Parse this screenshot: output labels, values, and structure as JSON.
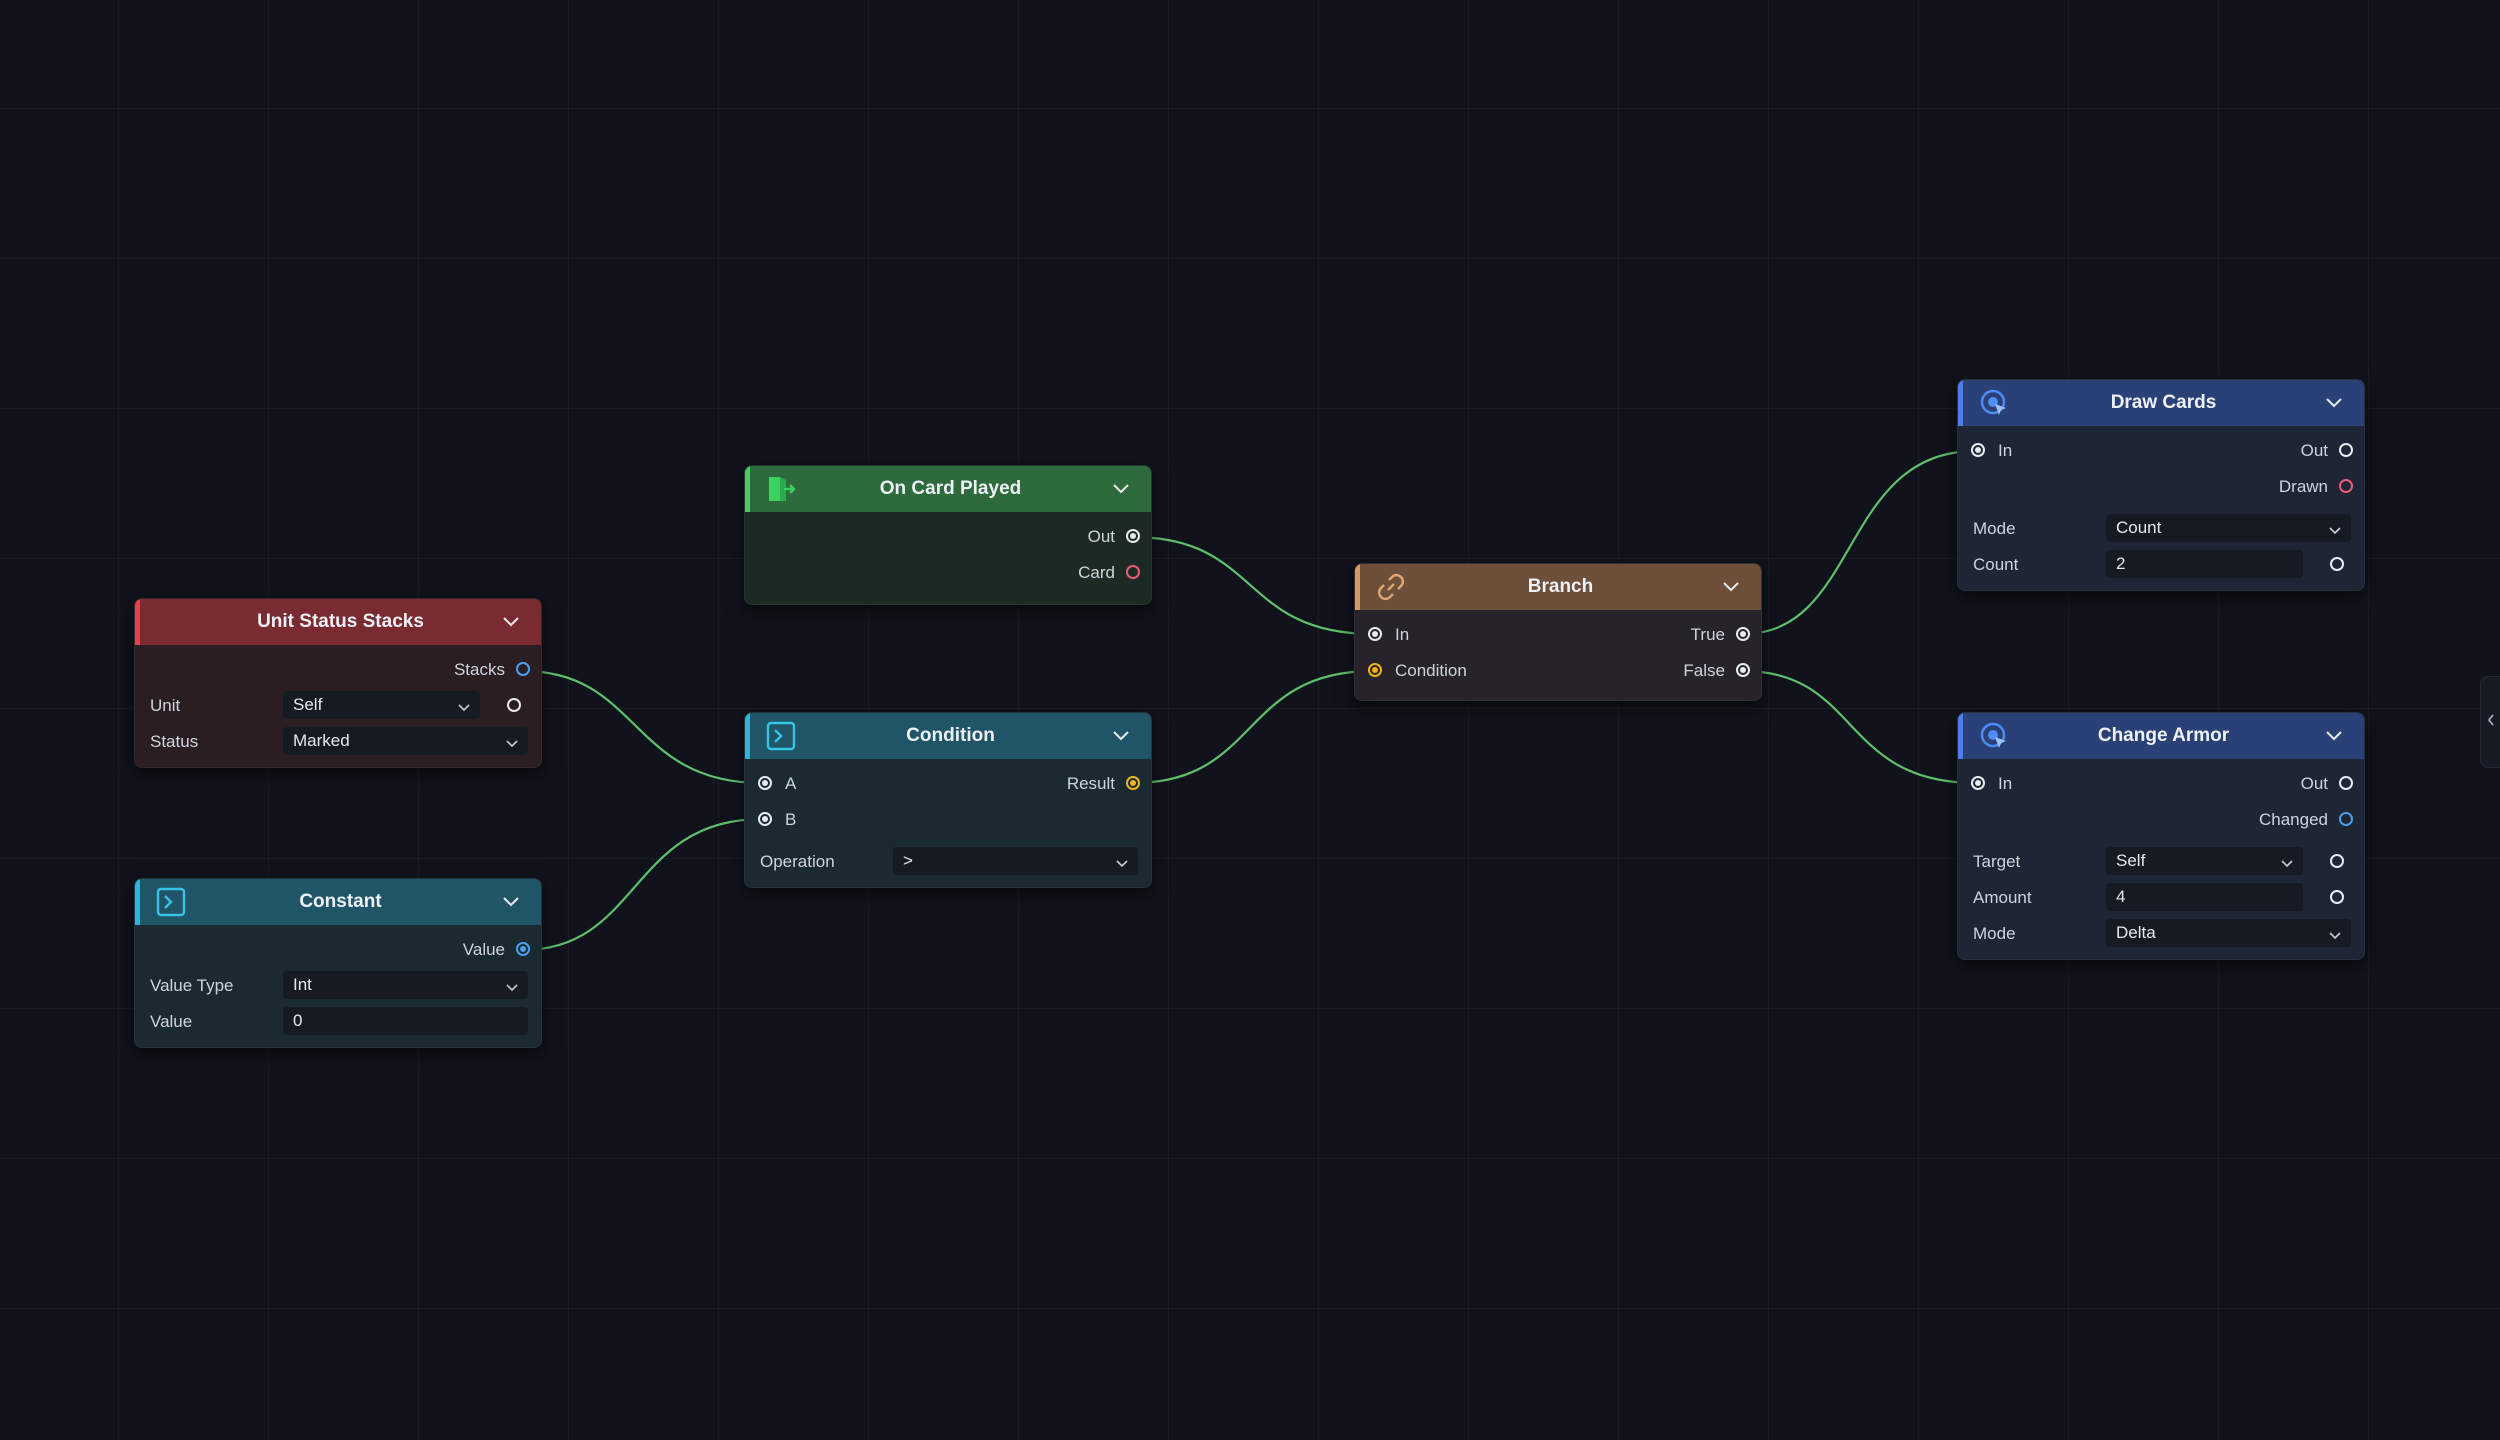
{
  "nodes": {
    "unit_status_stacks": {
      "title": "Unit Status Stacks",
      "outputs": [
        "Stacks"
      ],
      "fields": [
        {
          "label": "Unit",
          "value": "Self"
        },
        {
          "label": "Status",
          "value": "Marked"
        }
      ]
    },
    "constant": {
      "title": "Constant",
      "outputs": [
        "Value"
      ],
      "fields": [
        {
          "label": "Value Type",
          "value": "Int"
        },
        {
          "label": "Value",
          "value": "0"
        }
      ]
    },
    "on_card_played": {
      "title": "On Card Played",
      "outputs": [
        "Out",
        "Card"
      ]
    },
    "condition": {
      "title": "Condition",
      "inputs": [
        "A",
        "B"
      ],
      "outputs": [
        "Result"
      ],
      "fields": [
        {
          "label": "Operation",
          "value": ">"
        }
      ]
    },
    "branch": {
      "title": "Branch",
      "inputs": [
        "In",
        "Condition"
      ],
      "outputs": [
        "True",
        "False"
      ]
    },
    "draw_cards": {
      "title": "Draw Cards",
      "inputs": [
        "In"
      ],
      "outputs": [
        "Out",
        "Drawn"
      ],
      "fields": [
        {
          "label": "Mode",
          "value": "Count"
        },
        {
          "label": "Count",
          "value": "2"
        }
      ]
    },
    "change_armor": {
      "title": "Change Armor",
      "inputs": [
        "In"
      ],
      "outputs": [
        "Out",
        "Changed"
      ],
      "fields": [
        {
          "label": "Target",
          "value": "Self"
        },
        {
          "label": "Amount",
          "value": "4"
        },
        {
          "label": "Mode",
          "value": "Delta"
        }
      ]
    }
  },
  "colors": {
    "background": "#10131b",
    "wire": "#5fbf6c",
    "data_pin": "#4a9ff0",
    "bool_pin": "#f2b51c",
    "card_pin": "#f05a7a",
    "exec_pin": "#e8ebef",
    "header_unit_status": "#7a2a31",
    "header_event": "#2d6b3c",
    "header_math": "#1f5566",
    "header_flow": "#6d4f3a",
    "header_action": "#2a4178"
  },
  "icons": {
    "on_card_played": "exit-door-icon",
    "condition": "terminal-icon",
    "constant": "terminal-icon",
    "branch": "link-icon",
    "draw_cards": "target-cursor-icon",
    "change_armor": "target-cursor-icon"
  }
}
